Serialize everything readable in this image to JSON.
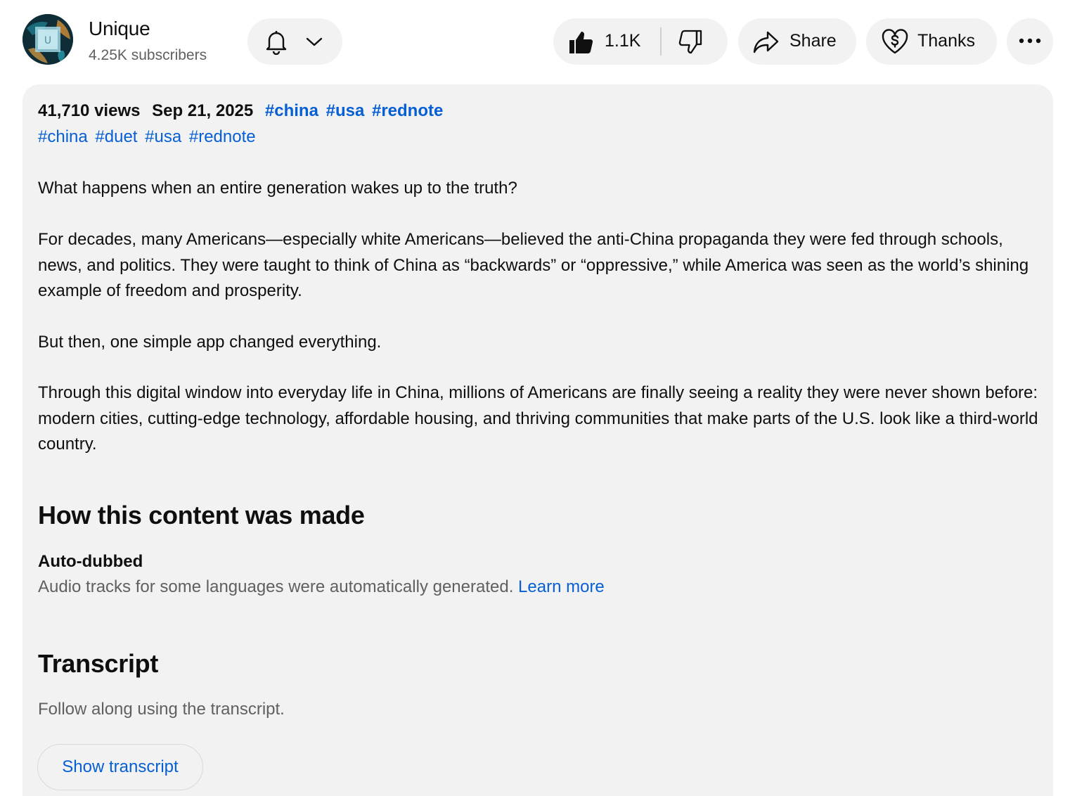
{
  "channel": {
    "name": "Unique",
    "subscribers": "4.25K subscribers",
    "avatar_letter": "U"
  },
  "actions": {
    "like_count": "1.1K",
    "share_label": "Share",
    "thanks_label": "Thanks",
    "more_label": "···"
  },
  "description": {
    "views": "41,710 views",
    "date": "Sep 21, 2025",
    "header_tags": [
      "#china",
      "#usa",
      "#rednote"
    ],
    "tags": [
      "#china",
      "#duet",
      "#usa",
      "#rednote"
    ],
    "paragraphs": [
      "What happens when an entire generation wakes up to the truth?",
      "For decades, many Americans—especially white Americans—believed the anti-China propaganda they were fed through schools, news, and politics. They were taught to think of China as “backwards” or “oppressive,” while America was seen as the world’s shining example of freedom and prosperity.",
      "But then, one simple app changed everything.",
      "Through this digital window into everyday life in China, millions of Americans are finally seeing a reality they were never shown before: modern cities, cutting-edge technology, affordable housing, and thriving communities that make parts of the U.S. look like a third-world country."
    ]
  },
  "how_made": {
    "title": "How this content was made",
    "subtitle": "Auto-dubbed",
    "text": "Audio tracks for some languages were automatically generated.",
    "link": "Learn more"
  },
  "transcript": {
    "title": "Transcript",
    "text": "Follow along using the transcript.",
    "button": "Show transcript"
  },
  "colors": {
    "link": "#065fd4",
    "panel": "#f2f2f2",
    "secondary_text": "#606060"
  },
  "icons": [
    "bell-icon",
    "chevron-down-icon",
    "thumbs-up-icon",
    "thumbs-down-icon",
    "share-icon",
    "thanks-icon",
    "more-icon"
  ]
}
